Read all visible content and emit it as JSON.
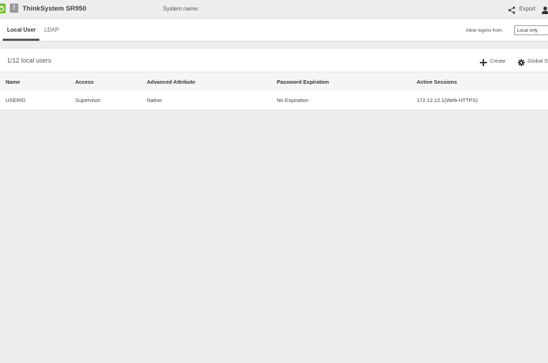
{
  "header": {
    "app_title": "ThinkSystem SR950",
    "system_name_label": "System name:",
    "warning_glyph": "!",
    "export_label": "Export",
    "icons": [
      "power-icon",
      "warning-icon",
      "share-icon",
      "user-icon"
    ]
  },
  "tabs": {
    "items": [
      {
        "label": "Local User",
        "active": true
      },
      {
        "label": "LDAP",
        "active": false
      }
    ],
    "allow_logons_label": "Allow logons from:",
    "allow_logons_value": "Local only"
  },
  "users": {
    "count_label": "1/12  local users",
    "create_label": "Create",
    "global_settings_label": "Global S",
    "columns": [
      "Name",
      "Access",
      "Advanced Attribute",
      "Password Expiration",
      "Active Sessions"
    ],
    "rows": [
      [
        "USERID",
        "Supervisor",
        "Native",
        "No Expiration",
        "172.12.12.1(Web-HTTPS)"
      ]
    ]
  },
  "colors": {
    "accent_green": "#6bbe2d",
    "background": "#eeeeee",
    "panel": "#ffffff"
  }
}
